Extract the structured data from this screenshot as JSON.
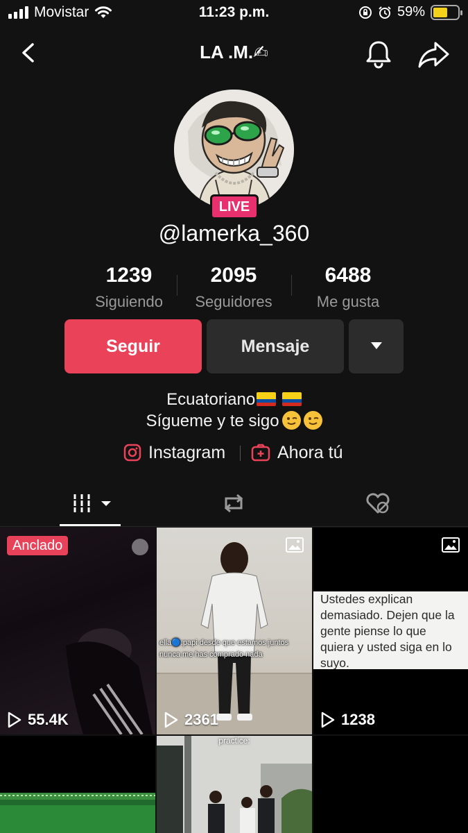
{
  "status_bar": {
    "carrier": "Movistar",
    "time": "11:23 p.m.",
    "battery": "59%",
    "battery_level": 0.59
  },
  "nav": {
    "title": "LA .M.✍"
  },
  "profile": {
    "live_badge": "LIVE",
    "username": "@lamerka_360",
    "stats": [
      {
        "value": "1239",
        "label": "Siguiendo"
      },
      {
        "value": "2095",
        "label": "Seguidores"
      },
      {
        "value": "6488",
        "label": "Me gusta"
      }
    ],
    "follow_label": "Seguir",
    "message_label": "Mensaje",
    "bio_line1": "Ecuatoriano",
    "bio_line2": "Sígueme y te sigo",
    "links": {
      "instagram": "Instagram",
      "ahora_tu": "Ahora tú"
    }
  },
  "colors": {
    "background": "#121212",
    "accent": "#ea4359",
    "live": "#e8306f",
    "secondary_button": "#2c2c2c",
    "muted_text": "#9a9a9a"
  },
  "tabs": [
    {
      "icon": "grid-icon",
      "active": true
    },
    {
      "icon": "repost-icon",
      "active": false
    },
    {
      "icon": "liked-hidden-icon",
      "active": false
    }
  ],
  "videos": [
    {
      "pinned_label": "Anclado",
      "views": "55.4K"
    },
    {
      "views": "2361",
      "overlay_text": "ella🔵:papi desde que estamos juntos nunca me has comprado nada",
      "photo": true
    },
    {
      "views": "1238",
      "photo": true,
      "note_text": "Ustedes explican demasiado. Dejen que la gente piense lo que quiera y usted siga en lo suyo."
    },
    {},
    {
      "overlay_text": "practice:"
    },
    {}
  ]
}
